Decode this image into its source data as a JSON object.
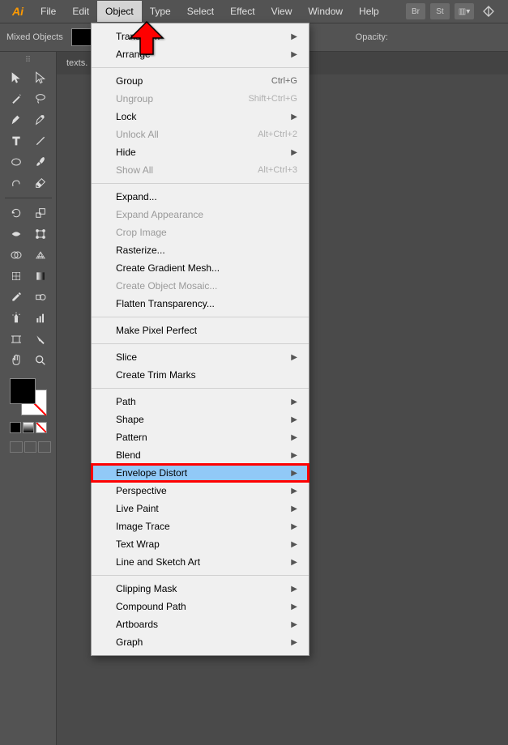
{
  "app_name": "Ai",
  "menubar": {
    "items": [
      "File",
      "Edit",
      "Object",
      "Type",
      "Select",
      "Effect",
      "View",
      "Window",
      "Help"
    ],
    "active_index": 2,
    "right_icons": [
      "Br",
      "St"
    ]
  },
  "control_bar": {
    "selection_label": "Mixed Objects",
    "opacity_label": "Opacity:"
  },
  "tab": {
    "label": "texts."
  },
  "dropdown": {
    "sections": [
      [
        {
          "label": "Transform",
          "submenu": true
        },
        {
          "label": "Arrange",
          "submenu": true
        }
      ],
      [
        {
          "label": "Group",
          "shortcut": "Ctrl+G"
        },
        {
          "label": "Ungroup",
          "shortcut": "Shift+Ctrl+G",
          "disabled": true
        },
        {
          "label": "Lock",
          "submenu": true
        },
        {
          "label": "Unlock All",
          "shortcut": "Alt+Ctrl+2",
          "disabled": true
        },
        {
          "label": "Hide",
          "submenu": true
        },
        {
          "label": "Show All",
          "shortcut": "Alt+Ctrl+3",
          "disabled": true
        }
      ],
      [
        {
          "label": "Expand..."
        },
        {
          "label": "Expand Appearance",
          "disabled": true
        },
        {
          "label": "Crop Image",
          "disabled": true
        },
        {
          "label": "Rasterize..."
        },
        {
          "label": "Create Gradient Mesh..."
        },
        {
          "label": "Create Object Mosaic...",
          "disabled": true
        },
        {
          "label": "Flatten Transparency..."
        }
      ],
      [
        {
          "label": "Make Pixel Perfect"
        }
      ],
      [
        {
          "label": "Slice",
          "submenu": true
        },
        {
          "label": "Create Trim Marks"
        }
      ],
      [
        {
          "label": "Path",
          "submenu": true
        },
        {
          "label": "Shape",
          "submenu": true
        },
        {
          "label": "Pattern",
          "submenu": true
        },
        {
          "label": "Blend",
          "submenu": true
        },
        {
          "label": "Envelope Distort",
          "submenu": true,
          "highlighted": true,
          "outlined": true
        },
        {
          "label": "Perspective",
          "submenu": true
        },
        {
          "label": "Live Paint",
          "submenu": true
        },
        {
          "label": "Image Trace",
          "submenu": true
        },
        {
          "label": "Text Wrap",
          "submenu": true
        },
        {
          "label": "Line and Sketch Art",
          "submenu": true
        }
      ],
      [
        {
          "label": "Clipping Mask",
          "submenu": true
        },
        {
          "label": "Compound Path",
          "submenu": true
        },
        {
          "label": "Artboards",
          "submenu": true
        },
        {
          "label": "Graph",
          "submenu": true
        }
      ]
    ]
  }
}
